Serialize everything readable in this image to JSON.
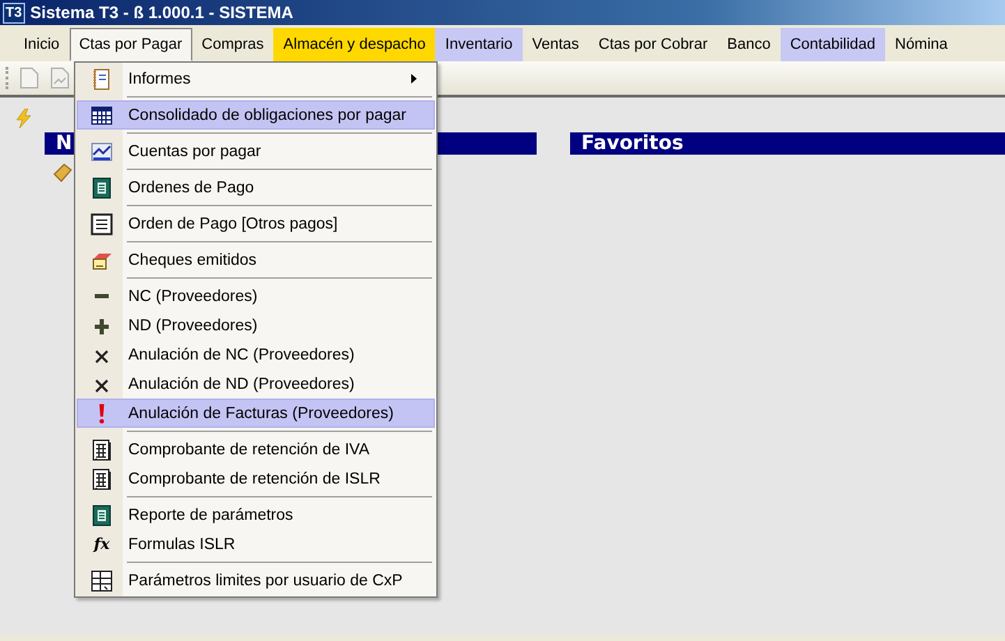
{
  "window": {
    "logo": "T3",
    "title": "Sistema T3 - ß 1.000.1 - SISTEMA"
  },
  "menu_bar": [
    {
      "label": "Inicio",
      "selected": false
    },
    {
      "label": "Ctas por Pagar",
      "selected": true
    },
    {
      "label": "Compras",
      "selected": false
    },
    {
      "label": "Almacén y despacho",
      "selected": false,
      "color": "#ffd800"
    },
    {
      "label": "Inventario",
      "selected": false,
      "color": "#c8c8f4"
    },
    {
      "label": "Ventas",
      "selected": false
    },
    {
      "label": "Ctas por Cobrar",
      "selected": false
    },
    {
      "label": "Banco",
      "selected": false
    },
    {
      "label": "Contabilidad",
      "selected": false,
      "color": "#c8c8f4"
    },
    {
      "label": "Nómina",
      "selected": false
    }
  ],
  "panels": [
    {
      "title": "N"
    },
    {
      "title": "Favoritos"
    }
  ],
  "dropdown": {
    "groups": [
      [
        {
          "label": "Informes",
          "kind": "notebook",
          "selected": false,
          "submenu": true
        }
      ],
      [
        {
          "label": "Consolidado de obligaciones por pagar",
          "kind": "grid",
          "selected": true,
          "submenu": false
        }
      ],
      [
        {
          "label": "Cuentas por pagar",
          "kind": "chart",
          "selected": false,
          "submenu": false
        }
      ],
      [
        {
          "label": "Ordenes de Pago",
          "kind": "form",
          "selected": false,
          "submenu": false
        }
      ],
      [
        {
          "label": "Orden de Pago [Otros pagos]",
          "kind": "list",
          "selected": false,
          "submenu": false
        }
      ],
      [
        {
          "label": "Cheques emitidos",
          "kind": "check",
          "selected": false,
          "submenu": false
        }
      ],
      [
        {
          "label": "NC (Proveedores)",
          "kind": "minus",
          "selected": false,
          "submenu": false
        },
        {
          "label": "ND (Proveedores)",
          "kind": "plus",
          "selected": false,
          "submenu": false
        },
        {
          "label": "Anulación de NC (Proveedores)",
          "kind": "cross",
          "selected": false,
          "submenu": false
        },
        {
          "label": "Anulación de ND (Proveedores)",
          "kind": "cross",
          "selected": false,
          "submenu": false
        },
        {
          "label": "Anulación de Facturas (Proveedores)",
          "kind": "alert",
          "selected": true,
          "submenu": false
        }
      ],
      [
        {
          "label": "Comprobante de retención de IVA",
          "kind": "calc",
          "selected": false,
          "submenu": false
        },
        {
          "label": "Comprobante de retención de ISLR",
          "kind": "calc",
          "selected": false,
          "submenu": false
        }
      ],
      [
        {
          "label": "Reporte de parámetros",
          "kind": "form",
          "selected": false,
          "submenu": false
        },
        {
          "label": "Formulas ISLR",
          "kind": "glyph",
          "glyph": "fx",
          "selected": false,
          "submenu": false
        }
      ],
      [
        {
          "label": "Parámetros limites por usuario de CxP",
          "kind": "table",
          "selected": false,
          "submenu": false
        }
      ]
    ]
  }
}
